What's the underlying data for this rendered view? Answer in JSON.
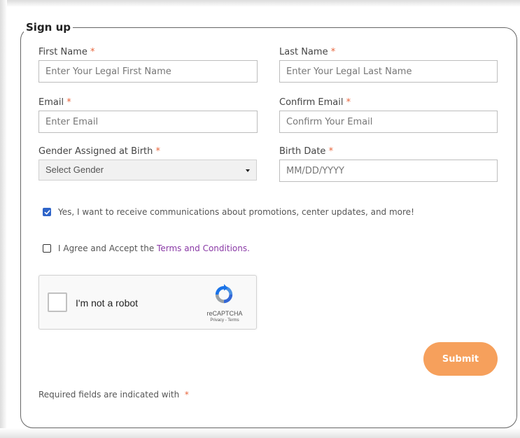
{
  "form": {
    "legend": "Sign up",
    "required_marker": "*",
    "fields": {
      "first_name": {
        "label": "First Name",
        "placeholder": "Enter Your Legal First Name"
      },
      "last_name": {
        "label": "Last Name",
        "placeholder": "Enter Your Legal Last Name"
      },
      "email": {
        "label": "Email",
        "placeholder": "Enter Email"
      },
      "confirm_email": {
        "label": "Confirm Email",
        "placeholder": "Confirm Your Email"
      },
      "gender": {
        "label": "Gender Assigned at Birth",
        "selected": "Select Gender"
      },
      "birth_date": {
        "label": "Birth Date",
        "placeholder": "MM/DD/YYYY"
      }
    },
    "communications": {
      "checked": true,
      "label": "Yes, I want to receive communications about promotions, center updates, and more!"
    },
    "terms": {
      "checked": false,
      "prefix": "I Agree and Accept the ",
      "link": "Terms and Conditions",
      "suffix": "."
    },
    "captcha": {
      "label": "I'm not a robot",
      "brand": "reCAPTCHA",
      "links": "Privacy - Terms"
    },
    "submit_label": "Submit",
    "footer_note": "Required fields are indicated with "
  },
  "colors": {
    "required": "#e8663d",
    "submit": "#f6a05c",
    "link": "#8a3aa6",
    "checkbox_checked": "#2e64c9"
  }
}
